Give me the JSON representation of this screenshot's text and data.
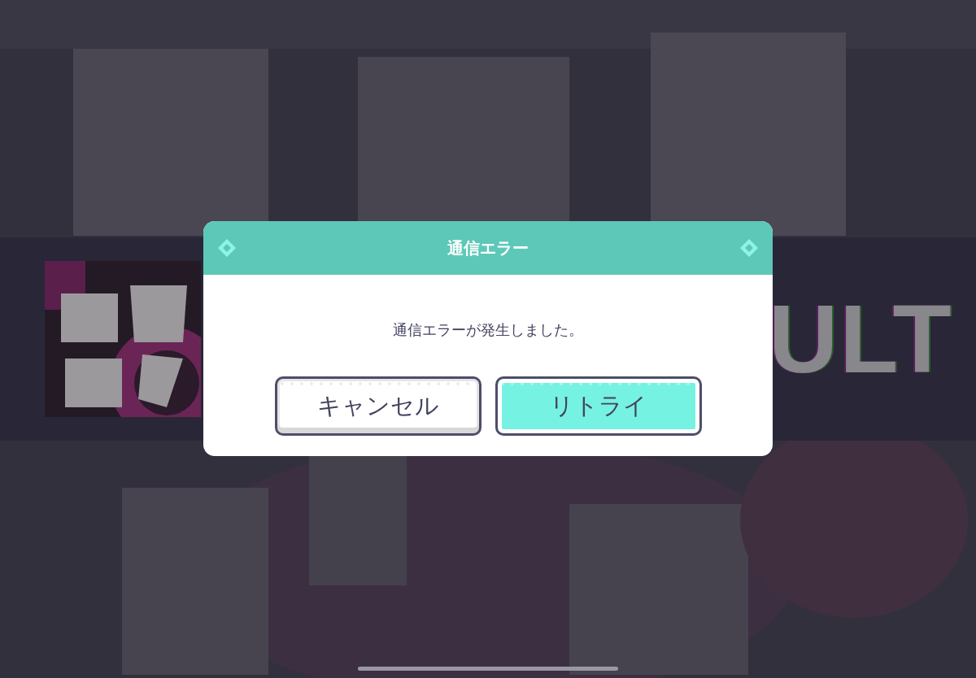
{
  "background": {
    "kind": "picture",
    "banner_text": "ULT"
  },
  "dialog": {
    "title": "通信エラー",
    "message": "通信エラーが発生しました。",
    "buttons": [
      {
        "label": "キャンセル",
        "kind": "secondary"
      },
      {
        "label": "リトライ",
        "kind": "primary"
      }
    ]
  }
}
